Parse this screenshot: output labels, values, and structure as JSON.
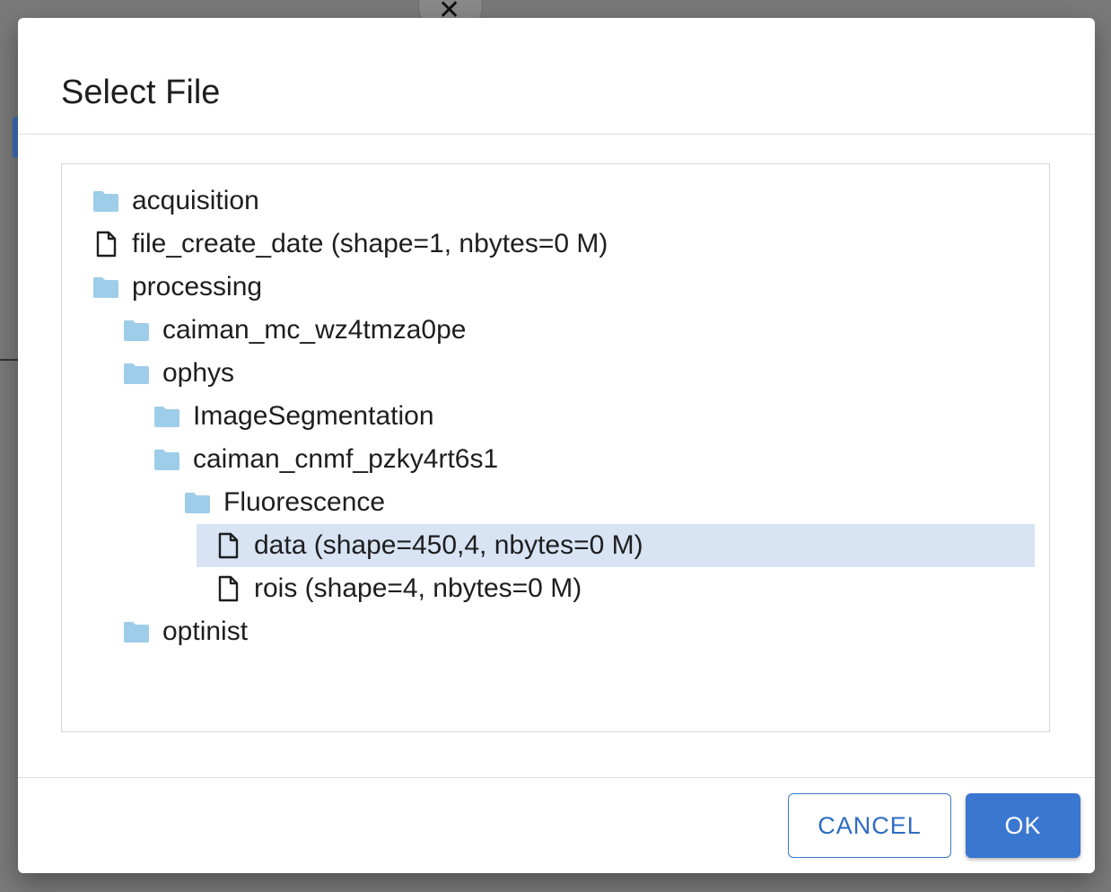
{
  "dialog": {
    "title": "Select File",
    "cancel_label": "CANCEL",
    "ok_label": "OK"
  },
  "colors": {
    "folder": "#9ecde9",
    "selected_row": "#d8e3f4",
    "primary": "#3a77d1"
  },
  "tree": {
    "items": [
      {
        "label": "acquisition",
        "type": "folder",
        "depth": 0
      },
      {
        "label": "file_create_date (shape=1, nbytes=0 M)",
        "type": "file",
        "depth": 0
      },
      {
        "label": "processing",
        "type": "folder",
        "depth": 0
      },
      {
        "label": "caiman_mc_wz4tmza0pe",
        "type": "folder",
        "depth": 1
      },
      {
        "label": "ophys",
        "type": "folder",
        "depth": 1
      },
      {
        "label": "ImageSegmentation",
        "type": "folder",
        "depth": 2
      },
      {
        "label": "caiman_cnmf_pzky4rt6s1",
        "type": "folder",
        "depth": 2
      },
      {
        "label": "Fluorescence",
        "type": "folder",
        "depth": 3
      },
      {
        "label": "data (shape=450,4, nbytes=0 M)",
        "type": "file",
        "depth": 4,
        "selected": true
      },
      {
        "label": "rois (shape=4, nbytes=0 M)",
        "type": "file",
        "depth": 4
      },
      {
        "label": "optinist",
        "type": "folder",
        "depth": 1
      }
    ]
  }
}
